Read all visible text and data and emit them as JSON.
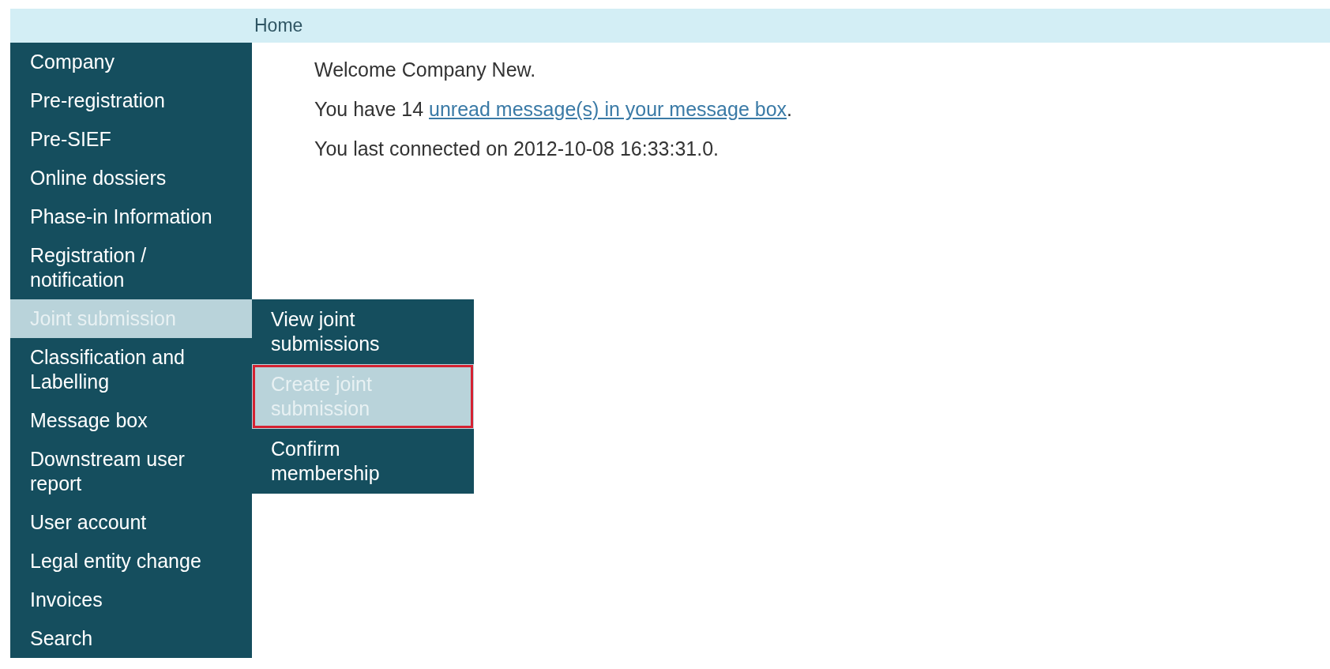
{
  "breadcrumb": "Home",
  "sidebar": {
    "items": [
      {
        "label": "Company",
        "selected": false
      },
      {
        "label": "Pre-registration",
        "selected": false
      },
      {
        "label": "Pre-SIEF",
        "selected": false
      },
      {
        "label": "Online dossiers",
        "selected": false
      },
      {
        "label": "Phase-in Information",
        "selected": false
      },
      {
        "label": "Registration / notification",
        "selected": false
      },
      {
        "label": "Joint submission",
        "selected": true,
        "children": [
          {
            "label": "View joint submissions",
            "selected": false
          },
          {
            "label": "Create joint submission",
            "selected": true
          },
          {
            "label": "Confirm membership",
            "selected": false
          }
        ]
      },
      {
        "label": "Classification and Labelling",
        "selected": false
      },
      {
        "label": "Message box",
        "selected": false
      },
      {
        "label": "Downstream user report",
        "selected": false
      },
      {
        "label": "User account",
        "selected": false
      },
      {
        "label": "Legal entity change",
        "selected": false
      },
      {
        "label": "Invoices",
        "selected": false
      },
      {
        "label": "Search",
        "selected": false
      }
    ]
  },
  "welcome": "Welcome Company New.",
  "messages": {
    "prefix": "You have 14",
    "link": "unread message(s) in your message box",
    "suffix": "."
  },
  "last_connected": "You last connected on 2012-10-08 16:33:31.0."
}
